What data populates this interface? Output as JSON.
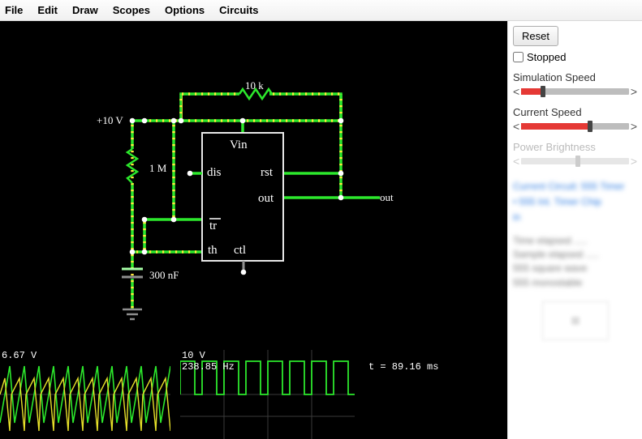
{
  "menu": {
    "items": [
      "File",
      "Edit",
      "Draw",
      "Scopes",
      "Options",
      "Circuits"
    ]
  },
  "controls": {
    "reset": "Reset",
    "stopped_label": "Stopped",
    "stopped": false,
    "sliders": [
      {
        "label": "Simulation Speed",
        "value": 0.18,
        "enabled": true
      },
      {
        "label": "Current Speed",
        "value": 0.62,
        "enabled": true
      },
      {
        "label": "Power Brightness",
        "value": 0.5,
        "enabled": false
      }
    ]
  },
  "links": [
    "Current Circuit: 555 Timer",
    "• 555 Int. Timer Chip",
    "in"
  ],
  "info_lines": [
    "Time elapsed .....",
    "Sample elapsed .....",
    "555 square wave",
    "555 monostable"
  ],
  "circuit": {
    "voltage_label": "+10 V",
    "r_feedback": "10 k",
    "r_discharge": "1 M",
    "cap": "300 nF",
    "out_label": "out",
    "chip_pins": {
      "vin": "Vin",
      "dis": "dis",
      "rst": "rst",
      "out": "out",
      "tr": "tr",
      "th": "th",
      "ctl": "ctl"
    }
  },
  "scopes": {
    "scope1": {
      "v": "6.67 V"
    },
    "scope2": {
      "v": "10 V",
      "f": "238.85 Hz"
    },
    "time": "t = 89.16 ms"
  }
}
